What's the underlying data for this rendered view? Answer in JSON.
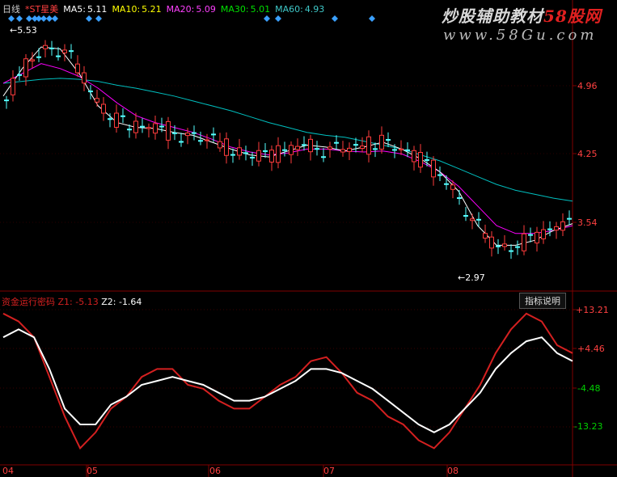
{
  "header": {
    "period": "日线",
    "stock": "*ST星美",
    "ma5_label": "MA5:",
    "ma5": "5.11",
    "ma10_label": "MA10:",
    "ma10": "5.21",
    "ma20_label": "MA20:",
    "ma20": "5.09",
    "ma30_label": "MA30:",
    "ma30": "5.01",
    "ma60_label": "MA60:",
    "ma60": "4.93"
  },
  "watermark": {
    "line1_a": "炒股辅助教材",
    "line1_b": "58股网",
    "line2": "www.58Gu.com"
  },
  "price_axis": [
    "4.96",
    "4.25",
    "3.54"
  ],
  "price_annotations": {
    "high": "5.53",
    "low": "2.97"
  },
  "indicator": {
    "name": "资金运行密码",
    "z1_label": "Z1:",
    "z1": "-5.13",
    "z2_label": "Z2:",
    "z2": "-1.64",
    "help_button": "指标说明",
    "axis": [
      "+13.21",
      "+4.46",
      "-4.48",
      "-13.23"
    ]
  },
  "time_axis": [
    "04",
    "05",
    "06",
    "07",
    "08"
  ],
  "colors": {
    "up": "#ff3c3c",
    "down": "#54ffff",
    "ma5": "#ffffff",
    "ma10": "#ffff00",
    "ma20": "#ff00ff",
    "ma30": "#00e000",
    "ma60": "#00bfbf",
    "z1": "#d42020",
    "z2": "#ffffff",
    "grid": "#800000",
    "marker": "#3aa0ff"
  },
  "chart_data": {
    "type": "line",
    "title": "*ST星美 日线",
    "price_range": [
      2.85,
      5.65
    ],
    "indicator_range": [
      -20,
      20
    ],
    "x": [
      "04",
      "05",
      "06",
      "07",
      "08"
    ],
    "series": [
      {
        "name": "MA5",
        "values": [
          4.82,
          5.1,
          5.32,
          5.3,
          5.05,
          4.72,
          4.55,
          4.5,
          4.49,
          4.45,
          4.42,
          4.35,
          4.28,
          4.22,
          4.2,
          4.26,
          4.32,
          4.3,
          4.26,
          4.3,
          4.35,
          4.28,
          4.18,
          4.05,
          3.85,
          3.5,
          3.3,
          3.3,
          3.35,
          3.45,
          3.52
        ]
      },
      {
        "name": "MA20",
        "values": [
          4.95,
          5.05,
          5.15,
          5.1,
          5.02,
          4.9,
          4.75,
          4.62,
          4.55,
          4.5,
          4.45,
          4.38,
          4.3,
          4.25,
          4.22,
          4.24,
          4.28,
          4.28,
          4.26,
          4.25,
          4.26,
          4.23,
          4.15,
          4.05,
          3.9,
          3.7,
          3.5,
          3.42,
          3.42,
          3.45,
          3.5
        ]
      },
      {
        "name": "MA60",
        "values": [
          4.95,
          4.97,
          4.99,
          5.0,
          4.99,
          4.97,
          4.93,
          4.9,
          4.86,
          4.82,
          4.77,
          4.72,
          4.67,
          4.61,
          4.55,
          4.5,
          4.45,
          4.42,
          4.4,
          4.36,
          4.32,
          4.28,
          4.22,
          4.16,
          4.08,
          4.0,
          3.92,
          3.86,
          3.82,
          3.78,
          3.75
        ]
      },
      {
        "name": "Z1",
        "values": [
          18,
          16,
          12,
          2,
          -8,
          -16,
          -12,
          -6,
          -3,
          2,
          4,
          4,
          0,
          -1,
          -4,
          -6,
          -6,
          -3,
          0,
          2,
          6,
          7,
          3,
          -2,
          -4,
          -8,
          -10,
          -14,
          -16,
          -12,
          -6,
          0,
          8,
          14,
          18,
          16,
          10,
          8
        ]
      },
      {
        "name": "Z2",
        "values": [
          12,
          14,
          12,
          4,
          -6,
          -10,
          -10,
          -5,
          -3,
          0,
          1,
          2,
          1,
          0,
          -2,
          -4,
          -4,
          -3,
          -1,
          1,
          4,
          4,
          3,
          1,
          -1,
          -4,
          -7,
          -10,
          -12,
          -10,
          -6,
          -2,
          4,
          8,
          11,
          12,
          8,
          6
        ]
      }
    ]
  }
}
